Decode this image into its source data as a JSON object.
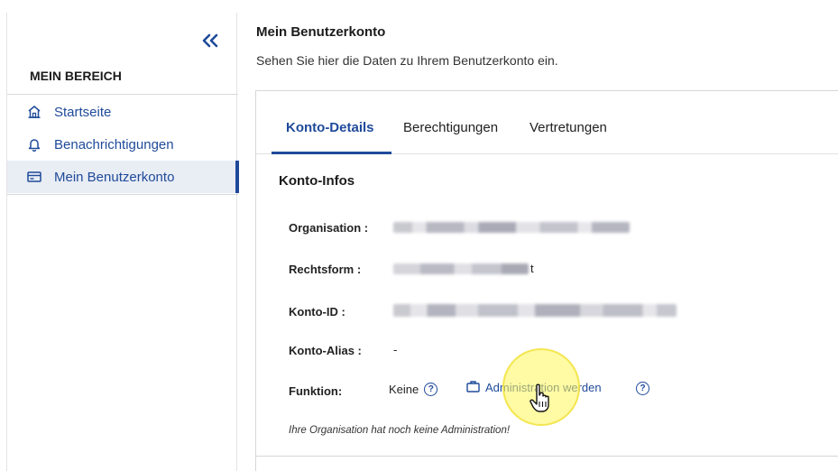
{
  "sidebar": {
    "collapse_icon": "double-chevron-left-icon",
    "title": "MEIN BEREICH",
    "items": [
      {
        "label": "Startseite",
        "icon": "home-icon"
      },
      {
        "label": "Benachrichtigungen",
        "icon": "bell-icon"
      },
      {
        "label": "Mein Benutzerkonto",
        "icon": "id-card-icon",
        "active": true
      }
    ]
  },
  "page": {
    "title": "Mein Benutzerkonto",
    "subtitle": "Sehen Sie hier die Daten zu Ihrem Benutzerkonto ein."
  },
  "tabs": [
    {
      "label": "Konto-Details",
      "active": true
    },
    {
      "label": "Berechtigungen"
    },
    {
      "label": "Vertretungen"
    }
  ],
  "konto_infos": {
    "title": "Konto-Infos",
    "organisation_label": "Organisation :",
    "rechtsform_label": "Rechtsform :",
    "rechtsform_visible_char": "t",
    "konto_id_label": "Konto-ID :",
    "konto_alias_label": "Konto-Alias :",
    "konto_alias_value": "-",
    "funktion_label": "Funktion:",
    "funktion_value": "Keine",
    "admin_link": "Administration werden",
    "note": "Ihre Organisation hat noch keine Administration!"
  },
  "colors": {
    "accent": "#1f4a9a",
    "active_bg": "#e9edf4",
    "click_highlight": "#fff65a"
  }
}
